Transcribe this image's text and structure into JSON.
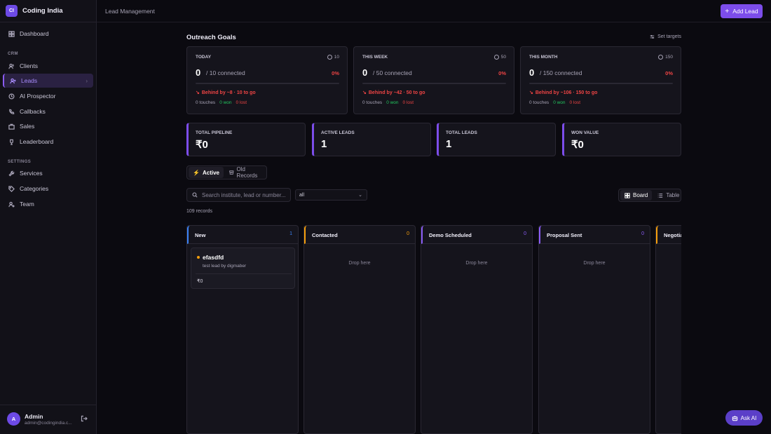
{
  "brand": {
    "logo_text": "CI",
    "name": "Coding India"
  },
  "sidebar": {
    "dashboard": "Dashboard",
    "crm_section": "CRM",
    "items_crm": [
      {
        "label": "Clients",
        "icon": "users-icon"
      },
      {
        "label": "Leads",
        "icon": "user-plus-icon",
        "active": true
      },
      {
        "label": "AI Prospector",
        "icon": "bot-icon"
      },
      {
        "label": "Callbacks",
        "icon": "phone-icon"
      },
      {
        "label": "Sales",
        "icon": "briefcase-icon"
      },
      {
        "label": "Leaderboard",
        "icon": "trophy-icon"
      }
    ],
    "settings_section": "SETTINGS",
    "items_settings": [
      {
        "label": "Services",
        "icon": "wrench-icon"
      },
      {
        "label": "Categories",
        "icon": "tag-icon"
      },
      {
        "label": "Team",
        "icon": "user-cog-icon"
      }
    ]
  },
  "user": {
    "initial": "A",
    "name": "Admin",
    "email": "admin@codingindia.c..."
  },
  "topbar": {
    "breadcrumb": "Lead Management",
    "add_lead": "Add Lead"
  },
  "goals": {
    "title": "Outreach Goals",
    "set_targets": "Set targets",
    "cards": [
      {
        "label": "TODAY",
        "target": "10",
        "count": "0",
        "of": "/ 10 connected",
        "pct": "0%",
        "progress": 0,
        "behind": "Behind by ~8 · 10 to go",
        "touches": "0 touches",
        "won": "0 won",
        "lost": "0 lost"
      },
      {
        "label": "THIS WEEK",
        "target": "50",
        "count": "0",
        "of": "/ 50 connected",
        "pct": "0%",
        "progress": 0,
        "behind": "Behind by ~42 · 50 to go",
        "touches": "0 touches",
        "won": "0 won",
        "lost": "0 lost"
      },
      {
        "label": "THIS MONTH",
        "target": "150",
        "count": "0",
        "of": "/ 150 connected",
        "pct": "0%",
        "progress": 0,
        "behind": "Behind by ~106 · 150 to go",
        "touches": "0 touches",
        "won": "0 won",
        "lost": "0 lost"
      }
    ]
  },
  "kpis": [
    {
      "label": "TOTAL PIPELINE",
      "value": "₹0"
    },
    {
      "label": "ACTIVE LEADS",
      "value": "1"
    },
    {
      "label": "TOTAL LEADS",
      "value": "1"
    },
    {
      "label": "WON VALUE",
      "value": "₹0"
    }
  ],
  "tabs": {
    "active": "Active",
    "old": "Old Records"
  },
  "search": {
    "placeholder": "Search institute, lead or number..."
  },
  "filter": {
    "value": "all"
  },
  "views": {
    "board": "Board",
    "table": "Table"
  },
  "records": "109 records",
  "board": {
    "drop_text": "Drop here",
    "columns": [
      {
        "title": "New",
        "count": "1",
        "color": "#3b82f6"
      },
      {
        "title": "Contacted",
        "count": "0",
        "color": "#f59e0b"
      },
      {
        "title": "Demo Scheduled",
        "count": "0",
        "color": "#8b5cf6"
      },
      {
        "title": "Proposal Sent",
        "count": "0",
        "color": "#8b5cf6"
      },
      {
        "title": "Negotia",
        "count": "",
        "color": "#f59e0b"
      }
    ],
    "lead": {
      "name": "efasdfd",
      "desc": "test lead by digmaber",
      "value": "₹0"
    }
  },
  "ask_ai": "Ask AI"
}
